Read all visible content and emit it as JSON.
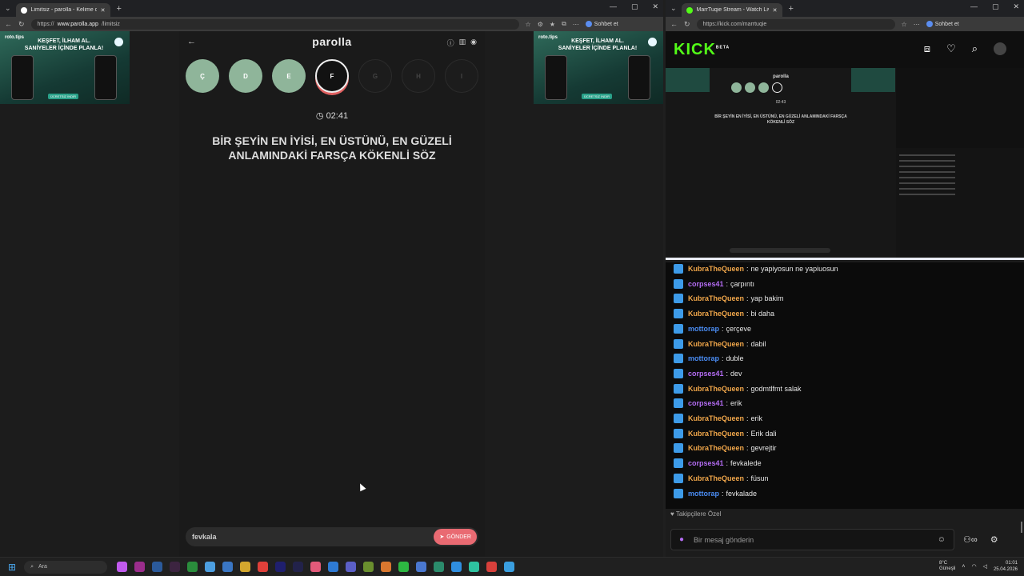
{
  "left_browser": {
    "tab_title": "Limitsiz - parolla - Kelime oyunu",
    "url_prefix": "https://",
    "url_host": "www.parolla.app",
    "url_path": "/limitsiz",
    "chat_button": "Sohbet et"
  },
  "ads": {
    "brand": "roto.tips",
    "slogan": "KEŞFET, İLHAM AL. SANİYELER İÇİNDE PLANLA!",
    "cta": "ÜCRETSİZ İNDİR"
  },
  "game": {
    "logo": "parolla",
    "letters": [
      {
        "char": "Ç",
        "state": "done"
      },
      {
        "char": "D",
        "state": "done"
      },
      {
        "char": "E",
        "state": "done"
      },
      {
        "char": "F",
        "state": "current"
      },
      {
        "char": "G",
        "state": "next"
      },
      {
        "char": "H",
        "state": "next"
      },
      {
        "char": "I",
        "state": "next"
      }
    ],
    "timer": "02:41",
    "question": "BİR ŞEYİN EN İYİSİ, EN ÜSTÜNÜ, EN GÜZELİ ANLAMINDAKİ FARSÇA KÖKENLİ SÖZ",
    "answer_value": "fevkala",
    "send_label": "GÖNDER"
  },
  "right_browser": {
    "tab_title": "MarrTuqie Stream - Watch Live on",
    "url": "https://kick.com/marrtuqie",
    "chat_button": "Sohbet et"
  },
  "kick": {
    "logo": "KICK",
    "beta": "BETA",
    "preview_logo": "parolla",
    "preview_timer": "02:43",
    "preview_question": "BİR ŞEYİN EN İYİSİ, EN ÜSTÜNÜ, EN GÜZELİ ANLAMINDAKİ FARSÇA KÖKENLİ SÖZ",
    "chat": [
      {
        "user": "KubraTheQueen",
        "color": "#f0a64a",
        "text": "ne yapiyosun ne yapiuosun"
      },
      {
        "user": "corpses41",
        "color": "#b36cf2",
        "text": "çarpıntı"
      },
      {
        "user": "KubraTheQueen",
        "color": "#f0a64a",
        "text": "yap bakim"
      },
      {
        "user": "KubraTheQueen",
        "color": "#f0a64a",
        "text": "bi daha"
      },
      {
        "user": "mottorap",
        "color": "#4a8cf2",
        "text": "çerçeve"
      },
      {
        "user": "KubraTheQueen",
        "color": "#f0a64a",
        "text": "dabil"
      },
      {
        "user": "mottorap",
        "color": "#4a8cf2",
        "text": "duble"
      },
      {
        "user": "corpses41",
        "color": "#b36cf2",
        "text": "dev"
      },
      {
        "user": "KubraTheQueen",
        "color": "#f0a64a",
        "text": "godmtlfmt salak"
      },
      {
        "user": "corpses41",
        "color": "#b36cf2",
        "text": "erik"
      },
      {
        "user": "KubraTheQueen",
        "color": "#f0a64a",
        "text": "erik"
      },
      {
        "user": "KubraTheQueen",
        "color": "#f0a64a",
        "text": "Erik dali"
      },
      {
        "user": "KubraTheQueen",
        "color": "#f0a64a",
        "text": "gevrejtir"
      },
      {
        "user": "corpses41",
        "color": "#b36cf2",
        "text": "fevkalede"
      },
      {
        "user": "KubraTheQueen",
        "color": "#f0a64a",
        "text": "füsun"
      },
      {
        "user": "mottorap",
        "color": "#4a8cf2",
        "text": "fevkalade"
      }
    ],
    "followers_only": "Takipçilere Özel",
    "input_placeholder": "Bir mesaj gönderin"
  },
  "taskbar": {
    "search_label": "Ara",
    "weather_temp": "8°C",
    "weather_desc": "Güneşli",
    "time": "01:01",
    "date": "25.04.2026"
  },
  "icons": {
    "back": "arrow-left-icon",
    "info": "info-icon",
    "stats": "chart-icon",
    "profile": "user-icon",
    "timer": "clock-icon"
  }
}
